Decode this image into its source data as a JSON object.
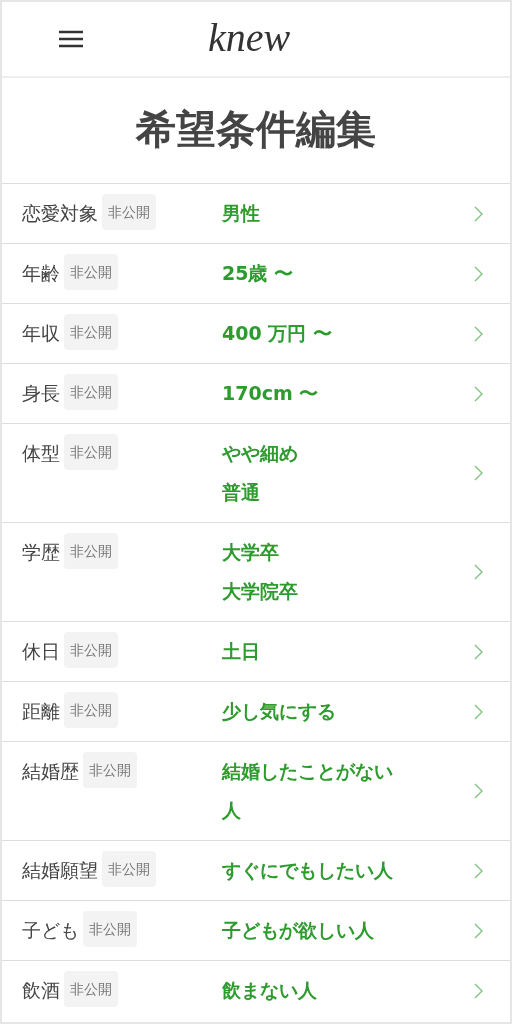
{
  "header": {
    "logo": "knew"
  },
  "title": "希望条件編集",
  "rows": [
    {
      "label": "恋愛対象",
      "badge": "非公開",
      "values": [
        "男性"
      ]
    },
    {
      "label": "年齢",
      "badge": "非公開",
      "values": [
        "25歳 〜"
      ]
    },
    {
      "label": "年収",
      "badge": "非公開",
      "values": [
        "400 万円 〜"
      ]
    },
    {
      "label": "身長",
      "badge": "非公開",
      "values": [
        "170cm 〜"
      ]
    },
    {
      "label": "体型",
      "badge": "非公開",
      "values": [
        "やや細め",
        "普通"
      ]
    },
    {
      "label": "学歴",
      "badge": "非公開",
      "values": [
        "大学卒",
        "大学院卒"
      ]
    },
    {
      "label": "休日",
      "badge": "非公開",
      "values": [
        "土日"
      ]
    },
    {
      "label": "距離",
      "badge": "非公開",
      "values": [
        "少し気にする"
      ]
    },
    {
      "label": "結婚歴",
      "badge": "非公開",
      "values": [
        "結婚したことがない",
        "人"
      ]
    },
    {
      "label": "結婚願望",
      "badge": "非公開",
      "values": [
        "すぐにでもしたい人"
      ]
    },
    {
      "label": "子ども",
      "badge": "非公開",
      "values": [
        "子どもが欲しい人"
      ]
    },
    {
      "label": "飲酒",
      "badge": "非公開",
      "values": [
        "飲まない人"
      ]
    }
  ]
}
